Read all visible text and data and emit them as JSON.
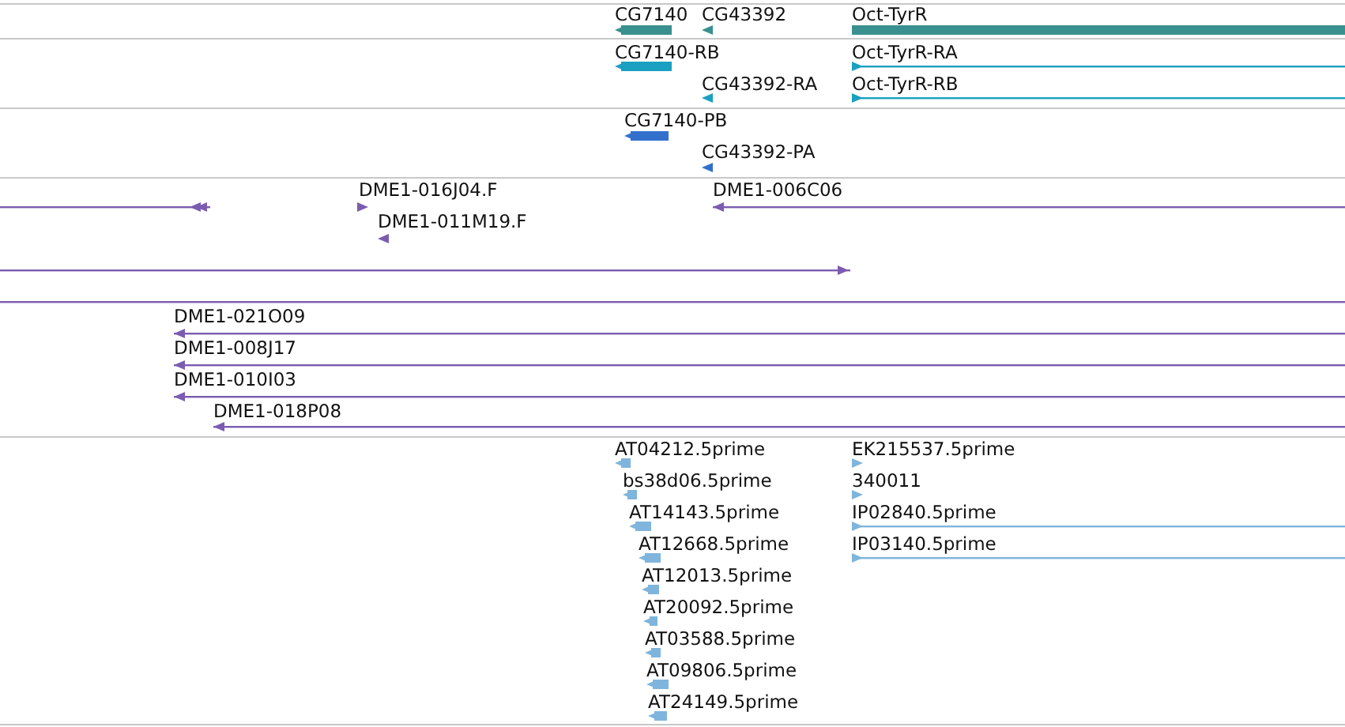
{
  "tracks": [
    {
      "kind": "gene",
      "features": [
        {
          "label": "CG7140",
          "kind": "stranded",
          "reverse": true
        },
        {
          "label": "CG43392",
          "kind": "stranded",
          "reverse": true
        },
        {
          "label": "Oct-TyrR",
          "kind": "span"
        }
      ]
    },
    {
      "kind": "mrna",
      "features": [
        {
          "label": "CG7140-RB",
          "kind": "stranded",
          "reverse": true
        },
        {
          "label": "CG43392-RA",
          "kind": "stranded",
          "reverse": true
        },
        {
          "label": "Oct-TyrR-RA",
          "kind": "stranded",
          "reverse": false
        },
        {
          "label": "Oct-TyrR-RB",
          "kind": "stranded",
          "reverse": false
        }
      ]
    },
    {
      "kind": "protein",
      "features": [
        {
          "label": "CG7140-PB",
          "kind": "stranded",
          "reverse": true
        },
        {
          "label": "CG43392-PA",
          "kind": "stranded",
          "reverse": true
        }
      ]
    },
    {
      "kind": "clone",
      "features": [
        {
          "kind": "stranded",
          "reverse": true
        },
        {
          "label": "DME1-016J04.F",
          "kind": "stranded",
          "reverse": false
        },
        {
          "label": "DME1-011M19.F",
          "kind": "stranded",
          "reverse": true
        },
        {
          "label": "DME1-006C06",
          "kind": "stranded",
          "reverse": true
        },
        {
          "kind": "stranded",
          "reverse": false
        },
        {
          "kind": "span"
        },
        {
          "label": "DME1-021O09",
          "kind": "stranded",
          "reverse": true
        },
        {
          "label": "DME1-008J17",
          "kind": "stranded",
          "reverse": true
        },
        {
          "label": "DME1-010I03",
          "kind": "stranded",
          "reverse": true
        },
        {
          "label": "DME1-018P08",
          "kind": "stranded",
          "reverse": true
        }
      ]
    },
    {
      "kind": "est",
      "features": [
        {
          "label": "AT04212.5prime",
          "kind": "stranded",
          "reverse": true
        },
        {
          "label": "bs38d06.5prime",
          "kind": "stranded",
          "reverse": true
        },
        {
          "label": "AT14143.5prime",
          "kind": "stranded",
          "reverse": true
        },
        {
          "label": "AT12668.5prime",
          "kind": "stranded",
          "reverse": true
        },
        {
          "label": "AT12013.5prime",
          "kind": "stranded",
          "reverse": true
        },
        {
          "label": "AT20092.5prime",
          "kind": "stranded",
          "reverse": true
        },
        {
          "label": "AT03588.5prime",
          "kind": "stranded",
          "reverse": true
        },
        {
          "label": "AT09806.5prime",
          "kind": "stranded",
          "reverse": true
        },
        {
          "label": "AT24149.5prime",
          "kind": "stranded",
          "reverse": true
        },
        {
          "label": "EK215537.5prime",
          "kind": "stranded",
          "reverse": false
        },
        {
          "label": "340011",
          "kind": "stranded",
          "reverse": false
        },
        {
          "label": "IP02840.5prime",
          "kind": "stranded",
          "reverse": false
        },
        {
          "label": "IP03140.5prime",
          "kind": "stranded",
          "reverse": false
        }
      ]
    }
  ]
}
